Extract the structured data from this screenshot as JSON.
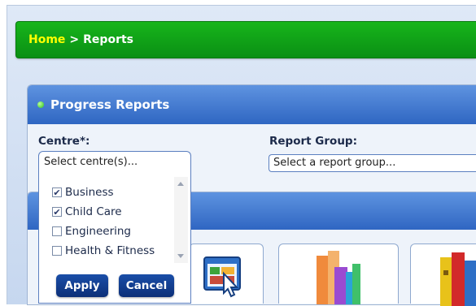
{
  "breadcrumb": {
    "home": "Home",
    "separator": ">",
    "current": "Reports"
  },
  "panel": {
    "title": "Progress Reports"
  },
  "filters": {
    "centre_label": "Centre*:",
    "centre_placeholder": "Select centre(s)...",
    "report_group_label": "Report Group:",
    "report_group_placeholder": "Select a report group..."
  },
  "centre_options": [
    {
      "label": "Business",
      "checked": true
    },
    {
      "label": "Child Care",
      "checked": true
    },
    {
      "label": "Engineering",
      "checked": false
    },
    {
      "label": "Health & Fitness",
      "checked": false
    }
  ],
  "buttons": {
    "apply": "Apply",
    "cancel": "Cancel"
  },
  "colors": {
    "breadcrumb_bg": "#12a018",
    "home_link": "#ffff00",
    "panel_header": "#3b73cc",
    "button": "#133f93"
  },
  "icons": [
    "report-window-icon",
    "bar-chart-icon",
    "books-icon"
  ]
}
